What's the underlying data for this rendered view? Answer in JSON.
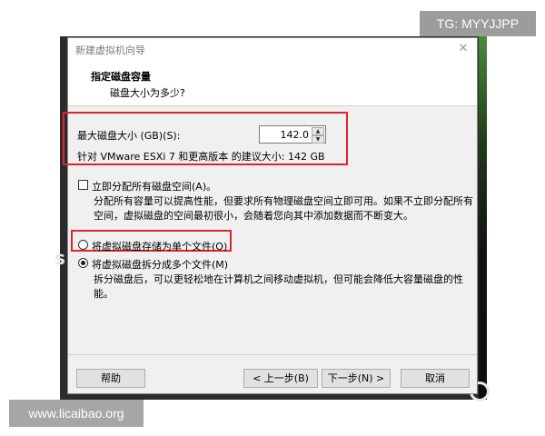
{
  "watermarks": {
    "top_right": "TG: MYYJJPP",
    "bottom_left": "www.licaibao.org"
  },
  "dialog": {
    "title": "新建虚拟机向导",
    "close_glyph": "✕",
    "header_title": "指定磁盘容量",
    "header_subtitle": "磁盘大小为多少?"
  },
  "disk": {
    "max_size_label": "最大磁盘大小 (GB)(S):",
    "max_size_value": "142.0",
    "recommend_text": "针对 VMware ESXi 7 和更高版本 的建议大小: 142 GB"
  },
  "allocate": {
    "label": "立即分配所有磁盘空间(A)。",
    "checked": false,
    "desc_line1": "分配所有容量可以提高性能，但要求所有物理磁盘空间立即可用。如果不立即分配所有",
    "desc_line2": "空间，虚拟磁盘的空间最初很小，会随着您向其中添加数据而不断变大。"
  },
  "storage_options": {
    "single_file_label": "将虚拟磁盘存储为单个文件(O)",
    "multi_file_label": "将虚拟磁盘拆分成多个文件(M)",
    "selected": "multi",
    "multi_desc_line1": "拆分磁盘后，可以更轻松地在计算机之间移动虚拟机，但可能会降低大容量磁盘的性",
    "multi_desc_line2": "能。"
  },
  "buttons": {
    "help": "帮助",
    "back": "< 上一步(B)",
    "next": "下一步(N) >",
    "cancel": "取消"
  },
  "colors": {
    "highlight": "#e0242a",
    "dialog_bg": "#f0f0f0",
    "desktop_bg": "#2b2b2b"
  }
}
